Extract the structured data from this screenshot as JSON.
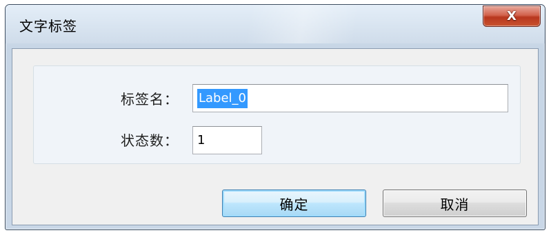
{
  "dialog": {
    "title": "文字标签",
    "close_label": "X"
  },
  "form": {
    "label_name": {
      "label": "标签名：",
      "value": "Label_0",
      "selected": true
    },
    "state_count": {
      "label": "状态数：",
      "value": "1"
    }
  },
  "buttons": {
    "ok": "确定",
    "cancel": "取消"
  },
  "colors": {
    "selection": "#3399ff",
    "close_button": "#c8432b",
    "ok_border": "#3c7fb1"
  }
}
